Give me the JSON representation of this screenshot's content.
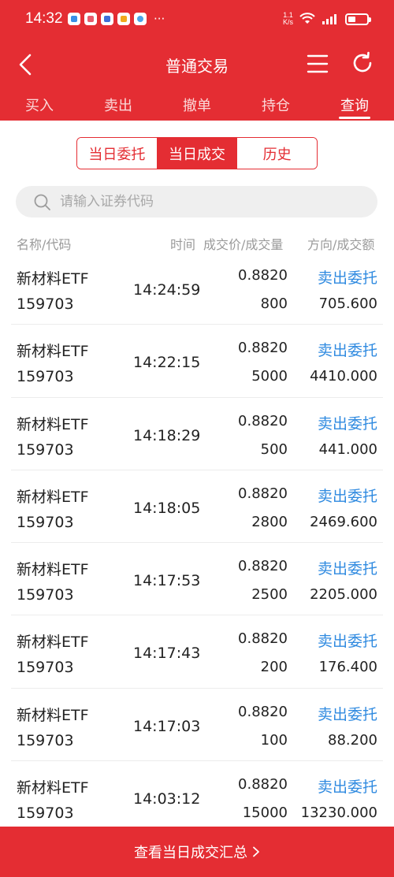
{
  "status_bar": {
    "time": "14:32",
    "net_speed_value": "1.1",
    "net_speed_unit": "K/s",
    "more": "···"
  },
  "header": {
    "title": "普通交易"
  },
  "tabs": [
    {
      "label": "买入",
      "active": false
    },
    {
      "label": "卖出",
      "active": false
    },
    {
      "label": "撤单",
      "active": false
    },
    {
      "label": "持仓",
      "active": false
    },
    {
      "label": "查询",
      "active": true
    }
  ],
  "segment": [
    {
      "label": "当日委托",
      "active": false
    },
    {
      "label": "当日成交",
      "active": true
    },
    {
      "label": "历史",
      "active": false
    }
  ],
  "search": {
    "placeholder": "请输入证券代码",
    "value": ""
  },
  "columns": {
    "name_code": "名称/代码",
    "time": "时间",
    "price_volume": "成交价/成交量",
    "direction_amount": "方向/成交额"
  },
  "rows": [
    {
      "name": "新材料ETF",
      "code": "159703",
      "time": "14:24:59",
      "price": "0.8820",
      "volume": "800",
      "direction": "卖出委托",
      "amount": "705.600"
    },
    {
      "name": "新材料ETF",
      "code": "159703",
      "time": "14:22:15",
      "price": "0.8820",
      "volume": "5000",
      "direction": "卖出委托",
      "amount": "4410.000"
    },
    {
      "name": "新材料ETF",
      "code": "159703",
      "time": "14:18:29",
      "price": "0.8820",
      "volume": "500",
      "direction": "卖出委托",
      "amount": "441.000"
    },
    {
      "name": "新材料ETF",
      "code": "159703",
      "time": "14:18:05",
      "price": "0.8820",
      "volume": "2800",
      "direction": "卖出委托",
      "amount": "2469.600"
    },
    {
      "name": "新材料ETF",
      "code": "159703",
      "time": "14:17:53",
      "price": "0.8820",
      "volume": "2500",
      "direction": "卖出委托",
      "amount": "2205.000"
    },
    {
      "name": "新材料ETF",
      "code": "159703",
      "time": "14:17:43",
      "price": "0.8820",
      "volume": "200",
      "direction": "卖出委托",
      "amount": "176.400"
    },
    {
      "name": "新材料ETF",
      "code": "159703",
      "time": "14:17:03",
      "price": "0.8820",
      "volume": "100",
      "direction": "卖出委托",
      "amount": "88.200"
    },
    {
      "name": "新材料ETF",
      "code": "159703",
      "time": "14:03:12",
      "price": "0.8820",
      "volume": "15000",
      "direction": "卖出委托",
      "amount": "13230.000"
    }
  ],
  "bottom": {
    "label": "查看当日成交汇总"
  },
  "colors": {
    "brand_red": "#e42d33",
    "direction_blue": "#2f8ae0",
    "muted_text": "#9a9a9a"
  },
  "icons": [
    "back-arrow-icon",
    "menu-icon",
    "refresh-icon",
    "search-icon",
    "chevron-right-icon",
    "wifi-icon",
    "signal-icon",
    "battery-icon"
  ]
}
